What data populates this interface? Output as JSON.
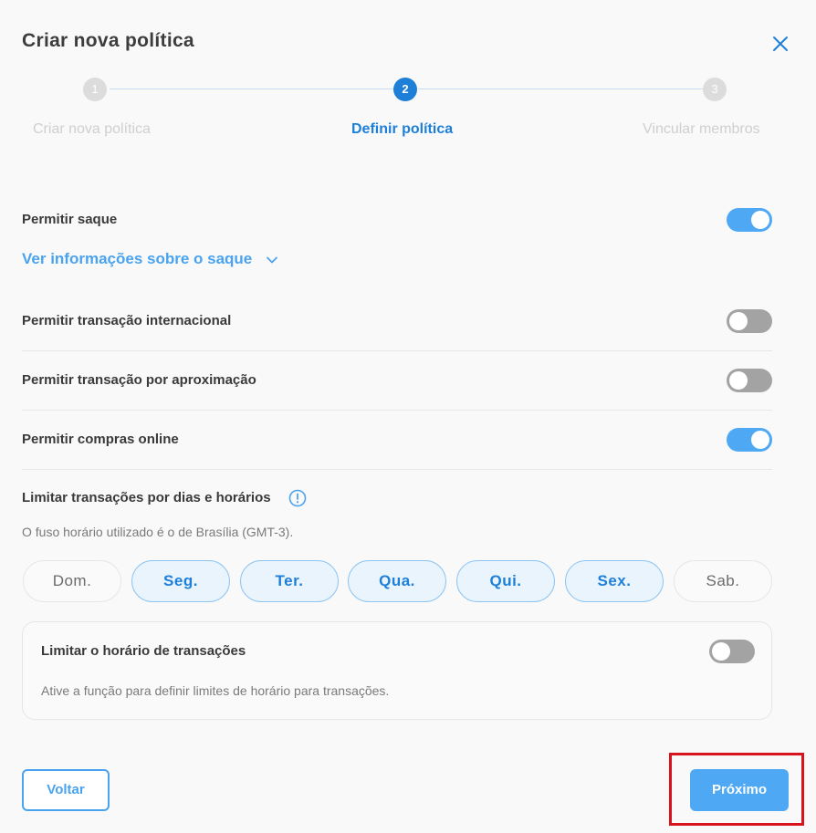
{
  "modal": {
    "title": "Criar nova política"
  },
  "stepper": {
    "steps": [
      {
        "number": "1",
        "label": "Criar nova política",
        "state": "inactive"
      },
      {
        "number": "2",
        "label": "Definir política",
        "state": "active"
      },
      {
        "number": "3",
        "label": "Vincular membros",
        "state": "inactive"
      }
    ]
  },
  "settings": {
    "withdraw": {
      "label": "Permitir saque",
      "enabled": true
    },
    "withdraw_info_link": "Ver informações sobre o saque",
    "international": {
      "label": "Permitir transação internacional",
      "enabled": false
    },
    "contactless": {
      "label": "Permitir transação por aproximação",
      "enabled": false
    },
    "online": {
      "label": "Permitir compras online",
      "enabled": true
    }
  },
  "schedule": {
    "label": "Limitar transações por dias e horários",
    "timezone_note": "O fuso horário utilizado é o de Brasília (GMT-3).",
    "days": [
      {
        "label": "Dom.",
        "selected": false
      },
      {
        "label": "Seg.",
        "selected": true
      },
      {
        "label": "Ter.",
        "selected": true
      },
      {
        "label": "Qua.",
        "selected": true
      },
      {
        "label": "Qui.",
        "selected": true
      },
      {
        "label": "Sex.",
        "selected": true
      },
      {
        "label": "Sab.",
        "selected": false
      }
    ],
    "time_limit": {
      "label": "Limitar o horário de transações",
      "description": "Ative a função para definir limites de horário para transações.",
      "enabled": false
    }
  },
  "footer": {
    "back_label": "Voltar",
    "next_label": "Próximo"
  },
  "colors": {
    "accent": "#1e7fd9",
    "toggle_on": "#4ea8f4",
    "toggle_off": "#a3a3a3",
    "highlight": "#d9131e"
  }
}
